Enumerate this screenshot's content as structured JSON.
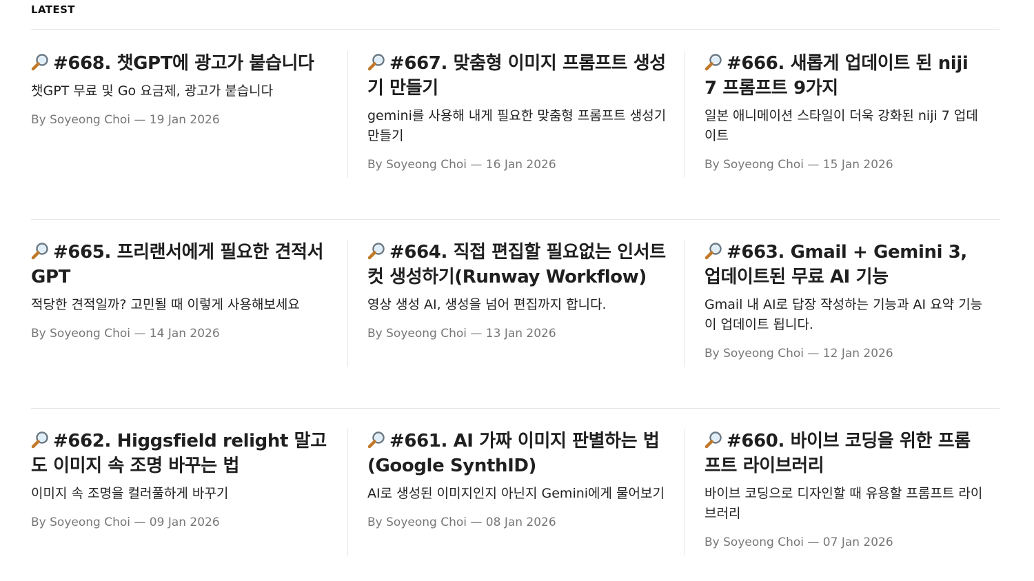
{
  "section": {
    "label": "LATEST"
  },
  "posts": [
    {
      "icon": "magnifier-icon",
      "title": "#668. 챗GPT에 광고가 붙습니다",
      "excerpt": "챗GPT 무료 및 Go 요금제, 광고가 붙습니다",
      "meta": "By Soyeong Choi — 19 Jan 2026"
    },
    {
      "icon": "magnifier-icon",
      "title": "#667. 맞춤형 이미지 프롬프트 생성기 만들기",
      "excerpt": "gemini를 사용해 내게 필요한 맞춤형 프롬프트 생성기 만들기",
      "meta": "By Soyeong Choi — 16 Jan 2026"
    },
    {
      "icon": "magnifier-icon",
      "title": "#666. 새롭게 업데이트 된 niji 7 프롬프트 9가지",
      "excerpt": "일본 애니메이션 스타일이 더욱 강화된 niji 7 업데이트",
      "meta": "By Soyeong Choi — 15 Jan 2026"
    },
    {
      "icon": "magnifier-icon",
      "title": "#665. 프리랜서에게 필요한 견적서 GPT",
      "excerpt": "적당한 견적일까? 고민될 때 이렇게 사용해보세요",
      "meta": "By Soyeong Choi — 14 Jan 2026"
    },
    {
      "icon": "magnifier-icon",
      "title": "#664. 직접 편집할 필요없는 인서트컷 생성하기(Runway Workflow)",
      "excerpt": "영상 생성 AI, 생성을 넘어 편집까지 합니다.",
      "meta": "By Soyeong Choi — 13 Jan 2026"
    },
    {
      "icon": "magnifier-icon",
      "title": "#663. Gmail + Gemini 3, 업데이트된 무료 AI 기능",
      "excerpt": "Gmail 내 AI로 답장 작성하는 기능과 AI 요약 기능이 업데이트 됩니다.",
      "meta": "By Soyeong Choi — 12 Jan 2026"
    },
    {
      "icon": "magnifier-icon",
      "title": "#662. Higgsfield relight 말고도 이미지 속 조명 바꾸는 법",
      "excerpt": "이미지 속 조명을 컬러풀하게 바꾸기",
      "meta": "By Soyeong Choi — 09 Jan 2026"
    },
    {
      "icon": "magnifier-icon",
      "title": "#661. AI 가짜 이미지 판별하는 법(Google SynthID)",
      "excerpt": "AI로 생성된 이미지인지 아닌지 Gemini에게 물어보기",
      "meta": "By Soyeong Choi — 08 Jan 2026"
    },
    {
      "icon": "magnifier-icon",
      "title": "#660. 바이브 코딩을 위한 프롬프트 라이브러리",
      "excerpt": "바이브 코딩으로 디자인할 때 유용할 프롬프트 라이브러리",
      "meta": "By Soyeong Choi — 07 Jan 2026"
    }
  ]
}
